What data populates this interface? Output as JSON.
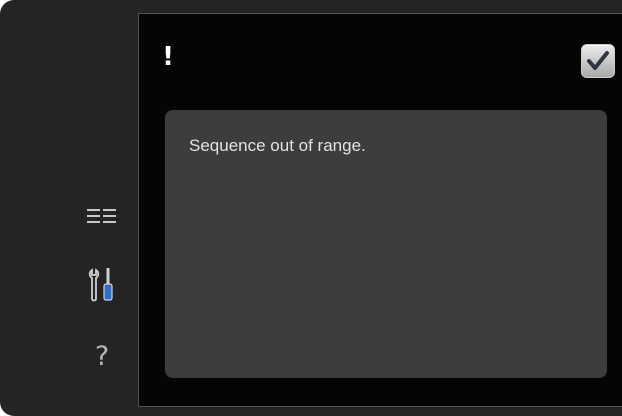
{
  "dialog": {
    "alert_symbol": "!",
    "message": "Sequence out of range.",
    "confirm_icon": "checkmark-icon"
  },
  "sidebar": {
    "icons": [
      "list-icon",
      "tools-icon",
      "help-icon"
    ],
    "help_glyph": "?"
  },
  "colors": {
    "device_frame": "#242424",
    "screen_background": "#050505",
    "panel_background": "#3d3d3d",
    "message_text": "#e2e2e2",
    "tools_accent": "#2a6fc9"
  }
}
